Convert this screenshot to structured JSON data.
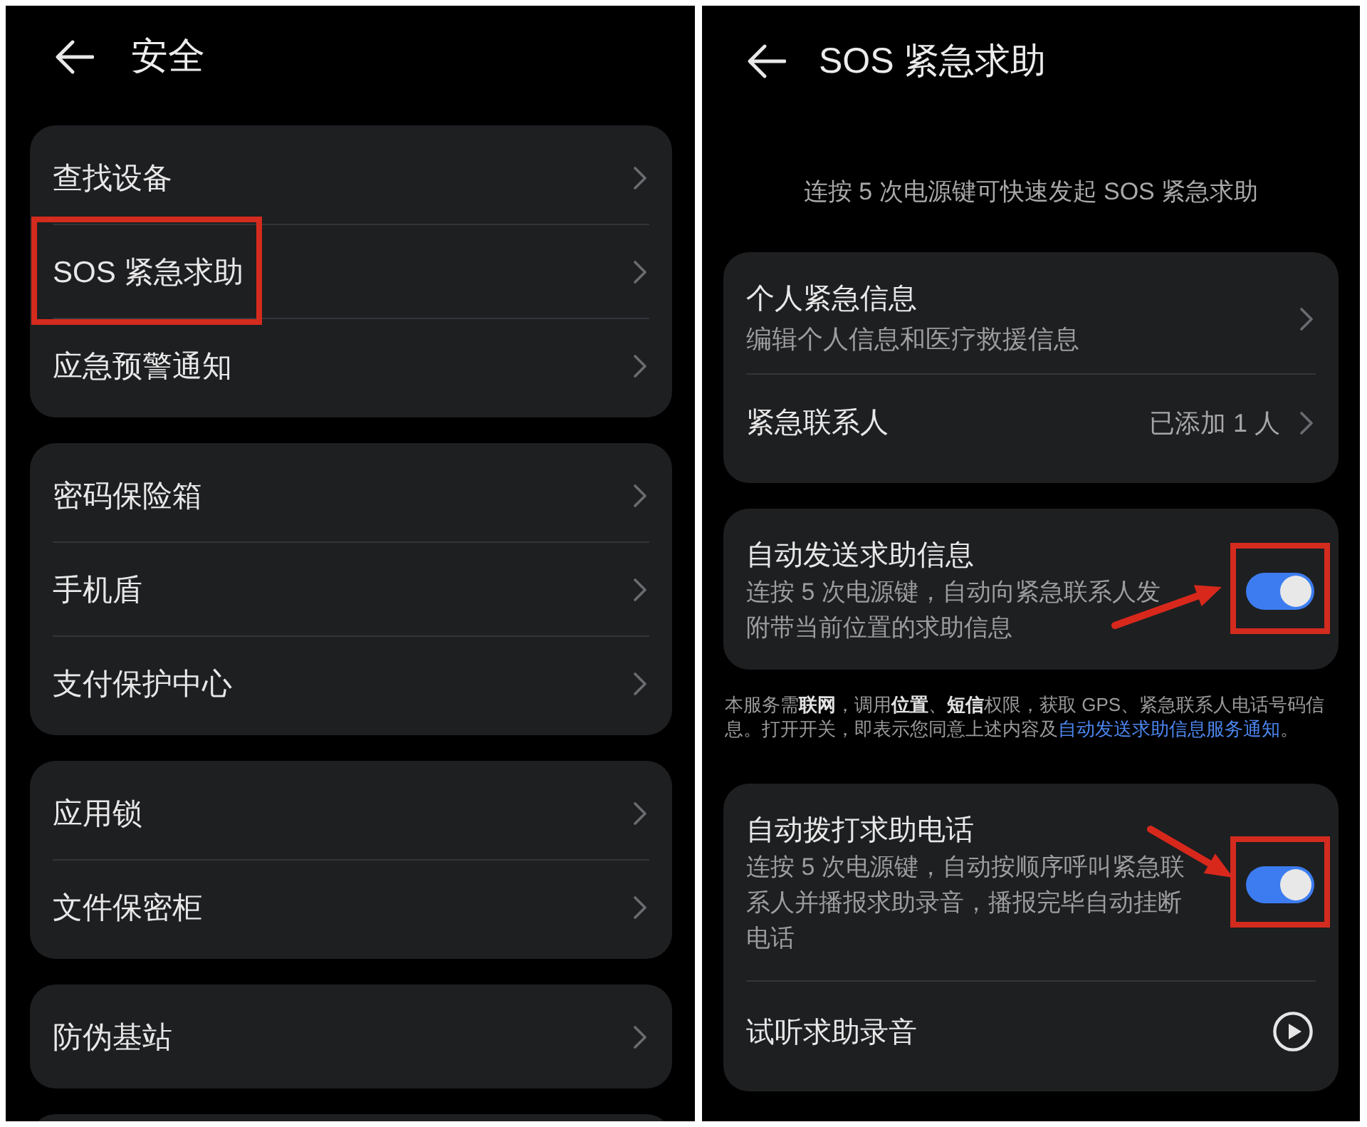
{
  "left_screen": {
    "title": "安全",
    "groups": [
      {
        "items": [
          {
            "label": "查找设备",
            "highlighted": false
          },
          {
            "label": "SOS 紧急求助",
            "highlighted": true
          },
          {
            "label": "应急预警通知",
            "highlighted": false
          }
        ]
      },
      {
        "items": [
          {
            "label": "密码保险箱",
            "highlighted": false
          },
          {
            "label": "手机盾",
            "highlighted": false
          },
          {
            "label": "支付保护中心",
            "highlighted": false
          }
        ]
      },
      {
        "items": [
          {
            "label": "应用锁",
            "highlighted": false
          },
          {
            "label": "文件保密柜",
            "highlighted": false
          }
        ]
      },
      {
        "items": [
          {
            "label": "防伪基站",
            "highlighted": false
          }
        ]
      }
    ]
  },
  "right_screen": {
    "title": "SOS 紧急求助",
    "intro": "连按 5 次电源键可快速发起 SOS 紧急求助",
    "groups": [
      {
        "items": [
          {
            "kind": "link",
            "title": "个人紧急信息",
            "subtitle": "编辑个人信息和医疗救援信息"
          },
          {
            "kind": "link",
            "title": "紧急联系人",
            "value": "已添加 1 人"
          }
        ]
      },
      {
        "items": [
          {
            "kind": "toggle",
            "title": "自动发送求助信息",
            "description_lines": [
              "连按 5 次电源键，自动向紧急联系人发",
              "附带当前位置的求助信息"
            ],
            "on": true,
            "highlighted": true,
            "arrow": true
          }
        ],
        "notice": {
          "text": "本服务需**联网**，调用**位置**、**短信**权限，获取 GPS、紧急联系人电话号码信息。打开开关，即表示您同意上述内容及",
          "link": "自动发送求助信息服务通知",
          "after": "。"
        }
      },
      {
        "items": [
          {
            "kind": "toggle",
            "title": "自动拨打求助电话",
            "description_lines": [
              "连按 5 次电源键，自动按顺序呼叫紧急联",
              "系人并播报求助录音，播报完毕自动挂断",
              "电话"
            ],
            "on": true,
            "highlighted": true,
            "arrow": true
          },
          {
            "kind": "play",
            "title": "试听求助录音"
          }
        ]
      }
    ]
  }
}
